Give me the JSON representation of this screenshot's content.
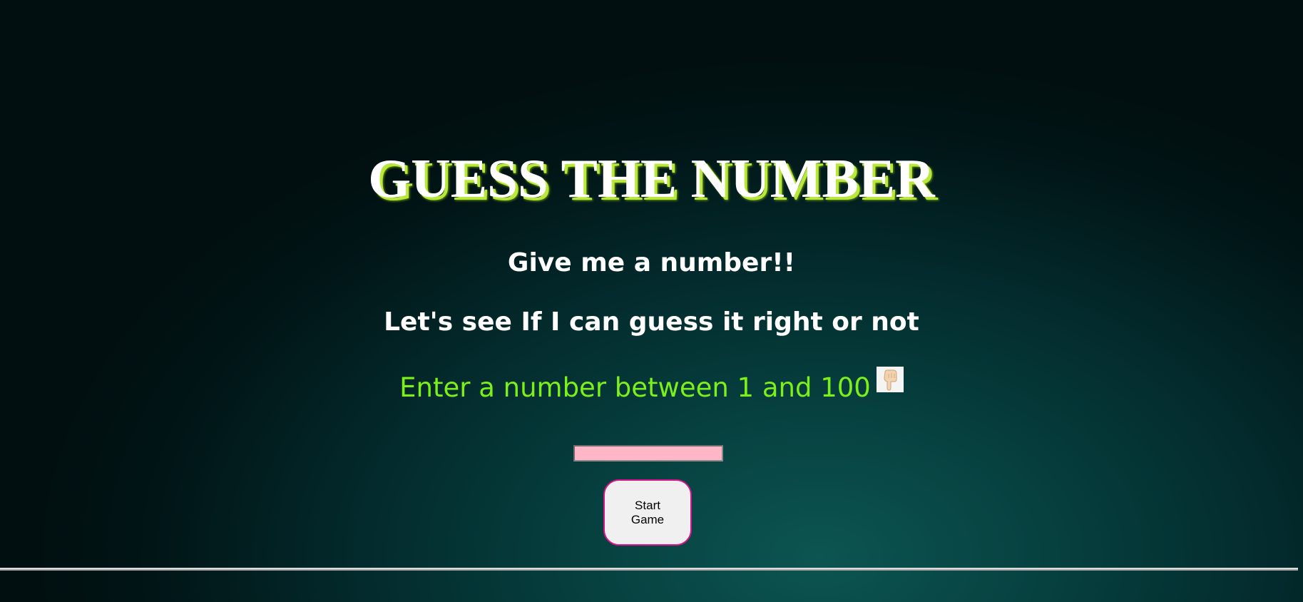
{
  "game": {
    "title": "GUESS THE NUMBER",
    "subtitle_line1": "Give me a number!!",
    "subtitle_line2": "Let's see If I can guess it right or not",
    "prompt": "Enter a number between 1 and 100",
    "prompt_icon": "pointing-down-hand-icon",
    "input_value": "",
    "start_button_label": "Start Game"
  },
  "colors": {
    "title": "#ffffff",
    "title_shadow": "#b8e83a",
    "subtitle": "#ffffff",
    "prompt": "#7cf01a",
    "input_background": "#ffb6c6",
    "button_border": "#d7158a",
    "button_background": "#f0f0f0",
    "background_dark": "#010f10",
    "background_glow": "#0c5551"
  }
}
